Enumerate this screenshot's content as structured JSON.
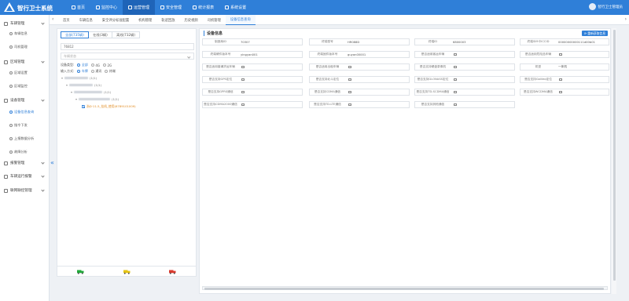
{
  "app": {
    "title": "智行卫士系统"
  },
  "nav": [
    {
      "label": "首页",
      "icon": "home-icon"
    },
    {
      "label": "监控中心",
      "icon": "monitor-icon"
    },
    {
      "label": "运营管理",
      "icon": "operations-icon",
      "active": true
    },
    {
      "label": "安全管理",
      "icon": "shield-icon"
    },
    {
      "label": "统计报表",
      "icon": "chart-icon"
    },
    {
      "label": "系统设置",
      "icon": "gear-icon"
    }
  ],
  "user": {
    "name": "智行卫士管理员"
  },
  "sidebar": {
    "groups": [
      {
        "label": "车辆管理",
        "children": [
          "车辆信息",
          "司机管理"
        ]
      },
      {
        "label": "区域管理",
        "children": [
          "区域设置",
          "区域监控"
        ]
      },
      {
        "label": "设备管理",
        "children": [
          "设备信息查询",
          "指令下发",
          "上报数据分析",
          "故障分析"
        ]
      },
      {
        "label": "报警管理",
        "children": []
      },
      {
        "label": "车辆运行报警",
        "children": []
      },
      {
        "label": "联网联控管理",
        "children": []
      }
    ],
    "active_item": "设备信息查询",
    "collapse_label": "«"
  },
  "tabs": [
    "首页",
    "车辆信息",
    "安全评分标准配置",
    "机构管理",
    "轨迹回放",
    "历史视频",
    "司机管理",
    "设备信息查询"
  ],
  "tab_nav": {
    "prev": "‹",
    "next": "›"
  },
  "left_panel": {
    "tabs": [
      "全部(735辆)",
      "在线(3辆)",
      "离线(732辆)"
    ],
    "search_value": "76812",
    "select_placeholder": "车辆状态",
    "device_type": {
      "label": "设备类型:",
      "options": [
        "全部",
        "4G",
        "2G"
      ],
      "selected": "全部"
    },
    "input_type": {
      "label": "输入方式:",
      "options": [
        "车牌",
        "通讯",
        "终端"
      ],
      "selected": "车牌"
    },
    "tree": [
      {
        "level": 0,
        "count": "(1/1)"
      },
      {
        "level": 1,
        "count": "(1/1)"
      },
      {
        "level": 2,
        "count": "(1/1)"
      },
      {
        "level": 3,
        "count": "(1/1)"
      }
    ],
    "vehicle": {
      "label": "浙D·11-5_挂机_使用(6789101009)"
    },
    "legend": [
      {
        "icon": "truck-online-icon",
        "color": "#22a93a"
      },
      {
        "icon": "truck-offline-icon",
        "color": "#e5c414"
      },
      {
        "icon": "truck-alarm-icon",
        "color": "#d93b2f"
      }
    ]
  },
  "right_panel": {
    "title": "设备信息",
    "action_label": "⟳ 重新获取信息",
    "fields": [
      {
        "label": "制造商ID",
        "value": "70307"
      },
      {
        "label": "终端型号",
        "value": "HR088D"
      },
      {
        "label": "终端ID",
        "value": "6800003"
      },
      {
        "label": "终端SIM卡ICCID",
        "value": "00000000000111d00b01"
      },
      {
        "label": "终端硬件版本号",
        "value": "yingyan001"
      },
      {
        "label": "终端固件版本号",
        "value": "guyan00001"
      },
      {
        "label": "是否适用客运车辆",
        "value": ""
      },
      {
        "label": "是否适用危险品车辆",
        "value": ""
      },
      {
        "label": "是否适用普通货运车辆",
        "value": ""
      },
      {
        "label": "是否适用出租车辆",
        "value": ""
      },
      {
        "label": "是否支持硬盘录像机",
        "value": ""
      },
      {
        "label": "机型",
        "value": "一体机"
      },
      {
        "label": "是否支持GPS定位",
        "value": ""
      },
      {
        "label": "是否支持北斗定位",
        "value": ""
      },
      {
        "label": "是否支持GLONASS定位",
        "value": ""
      },
      {
        "label": "是否支持Galileo定位",
        "value": ""
      },
      {
        "label": "是否支持GPRS通信",
        "value": ""
      },
      {
        "label": "是否支持CDMA通信",
        "value": ""
      },
      {
        "label": "是否支持TD-SCDMA通信",
        "value": ""
      },
      {
        "label": "是否支持WCDMA通信",
        "value": ""
      },
      {
        "label": "是否支持CDMA2000通信",
        "value": ""
      },
      {
        "label": "是否支持TD-LTE通信",
        "value": ""
      },
      {
        "label": "是否支持其他通信",
        "value": ""
      }
    ]
  },
  "colors": {
    "primary": "#2f7fd8",
    "topbar": "#2f7fd8",
    "warning": "#e08a1f"
  }
}
